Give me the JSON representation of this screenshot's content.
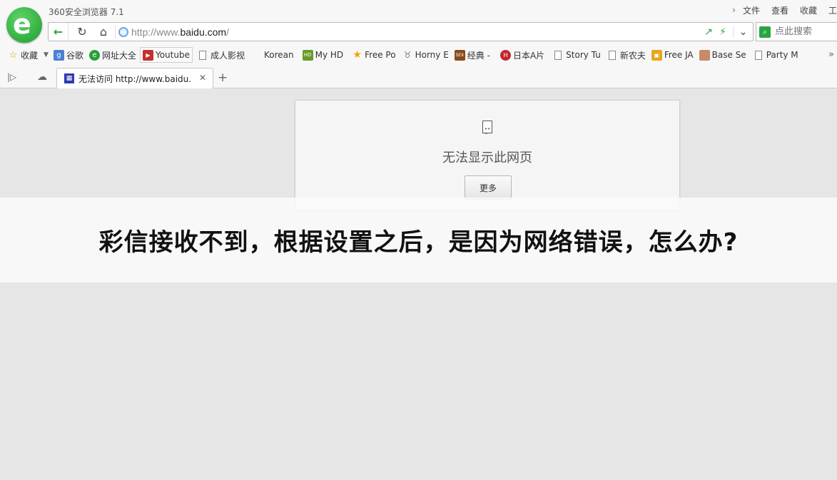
{
  "window": {
    "title": "360安全浏览器 7.1"
  },
  "menu": {
    "items": [
      "文件",
      "查看",
      "收藏",
      "工"
    ]
  },
  "address_bar": {
    "url_prefix": "http://www.",
    "url_domain": "baidu.com",
    "url_suffix": "/"
  },
  "search": {
    "placeholder": "点此搜索"
  },
  "bookmarks": [
    {
      "label": "收藏",
      "icon": "star-add-icon"
    },
    {
      "label": "谷歌",
      "icon": "google-icon"
    },
    {
      "label": "网址大全",
      "icon": "site-nav-icon"
    },
    {
      "label": "Youtube",
      "icon": "youtube-icon"
    },
    {
      "label": "成人影视",
      "icon": "page-icon"
    },
    {
      "label": "Korean",
      "icon": "none"
    },
    {
      "label": "My HD",
      "icon": "hd-icon"
    },
    {
      "label": "Free Po",
      "icon": "star-icon"
    },
    {
      "label": "Horny E",
      "icon": "elephant-icon"
    },
    {
      "label": "经典 -",
      "icon": "sex-icon"
    },
    {
      "label": "日本A片",
      "icon": "red-circle-icon"
    },
    {
      "label": "Story Tu",
      "icon": "page-icon"
    },
    {
      "label": "新农夫",
      "icon": "page-icon"
    },
    {
      "label": "Free JA",
      "icon": "camera-icon"
    },
    {
      "label": "Base Se",
      "icon": "photo-icon"
    },
    {
      "label": "Party M",
      "icon": "page-icon"
    }
  ],
  "tab": {
    "title": "无法访问 http://www.baidu.c"
  },
  "error": {
    "message": "无法显示此网页",
    "button": "更多"
  },
  "overlay": {
    "text": "彩信接收不到，根据设置之后，是因为网络错误，怎么办?"
  },
  "colors": {
    "accent": "#2aa53d",
    "background": "#e6e6e6"
  }
}
